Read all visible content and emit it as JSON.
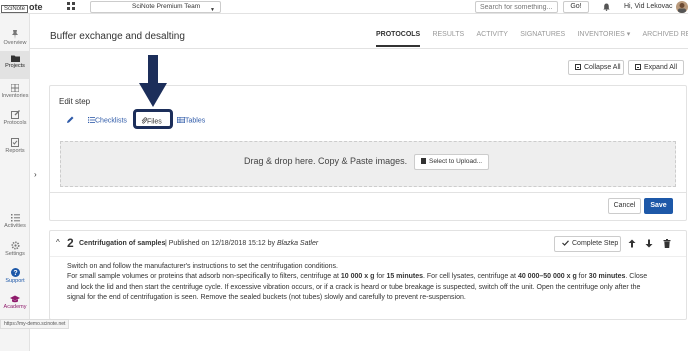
{
  "topbar": {
    "logo_box": "SciNote",
    "logo_tail": "ote",
    "team": "SciNote Premium Team",
    "search_placeholder": "Search for something...",
    "go_label": "Go!",
    "user_name": "Hi, Vid Lekovac"
  },
  "sidebar": {
    "items": [
      {
        "label": "Overview",
        "icon": "pin-icon"
      },
      {
        "label": "Projects",
        "icon": "folder-icon"
      },
      {
        "label": "Inventories",
        "icon": "grid-icon"
      },
      {
        "label": "Protocols",
        "icon": "pencil-square-icon"
      },
      {
        "label": "Reports",
        "icon": "checklist-icon"
      },
      {
        "label": "Activities",
        "icon": "list-icon"
      },
      {
        "label": "Settings",
        "icon": "gear-icon"
      },
      {
        "label": "Support",
        "icon": "help-icon"
      },
      {
        "label": "Academy",
        "icon": "graduation-cap-icon"
      }
    ],
    "toggle": "›"
  },
  "header": {
    "title": "Buffer exchange and desalting",
    "tabs": [
      {
        "label": "PROTOCOLS"
      },
      {
        "label": "RESULTS"
      },
      {
        "label": "ACTIVITY"
      },
      {
        "label": "SIGNATURES"
      },
      {
        "label": "INVENTORIES ▾"
      },
      {
        "label": "ARCHIVED RESULTS"
      }
    ]
  },
  "actions": {
    "collapse_label": "Collapse All",
    "expand_label": "Expand All"
  },
  "edit_step": {
    "title": "Edit step",
    "checklists_label": "Checklists",
    "files_label": "Files",
    "tables_label": "Tables",
    "drop_text": "Drag & drop here. Copy & Paste images.",
    "upload_label": "Select to Upload...",
    "cancel_label": "Cancel",
    "save_label": "Save"
  },
  "step": {
    "chevron": "^",
    "number": "2",
    "name": "Centrifugation of samples",
    "meta_prefix": "| Published on 12/18/2018 15:12 by ",
    "author": "Blazka Satler",
    "complete_label": "Complete Step",
    "lines": {
      "l1": "Switch on and follow the manufacturer's instructions to set the centrifugation conditions.",
      "l2a": "For small sample volumes or proteins that adsorb non-specifically to filters, centrifuge at ",
      "l2b": "10 000 x g",
      "l2c": " for ",
      "l2d": "15 minutes",
      "l2e": ". For cell lysates, centrifuge at ",
      "l2f": "40 000–50 000 x g",
      "l2g": " for ",
      "l2h": "30 minutes",
      "l2i": ". Close",
      "l3": "and lock the lid and then start the centrifuge cycle. If excessive vibration occurs, or if a crack is heard or tube breakage is suspected, switch off the unit. Open the centrifuge only after the",
      "l4": "signal for the end of centrifugation is seen. Remove the sealed buckets (not tubes) slowly and carefully to prevent re-suspension."
    }
  },
  "status_url": "https://my-demo.scinote.net",
  "colors": {
    "accent": "#1d58a8",
    "highlight": "#1c2e5a",
    "link": "#2e5aa8"
  }
}
